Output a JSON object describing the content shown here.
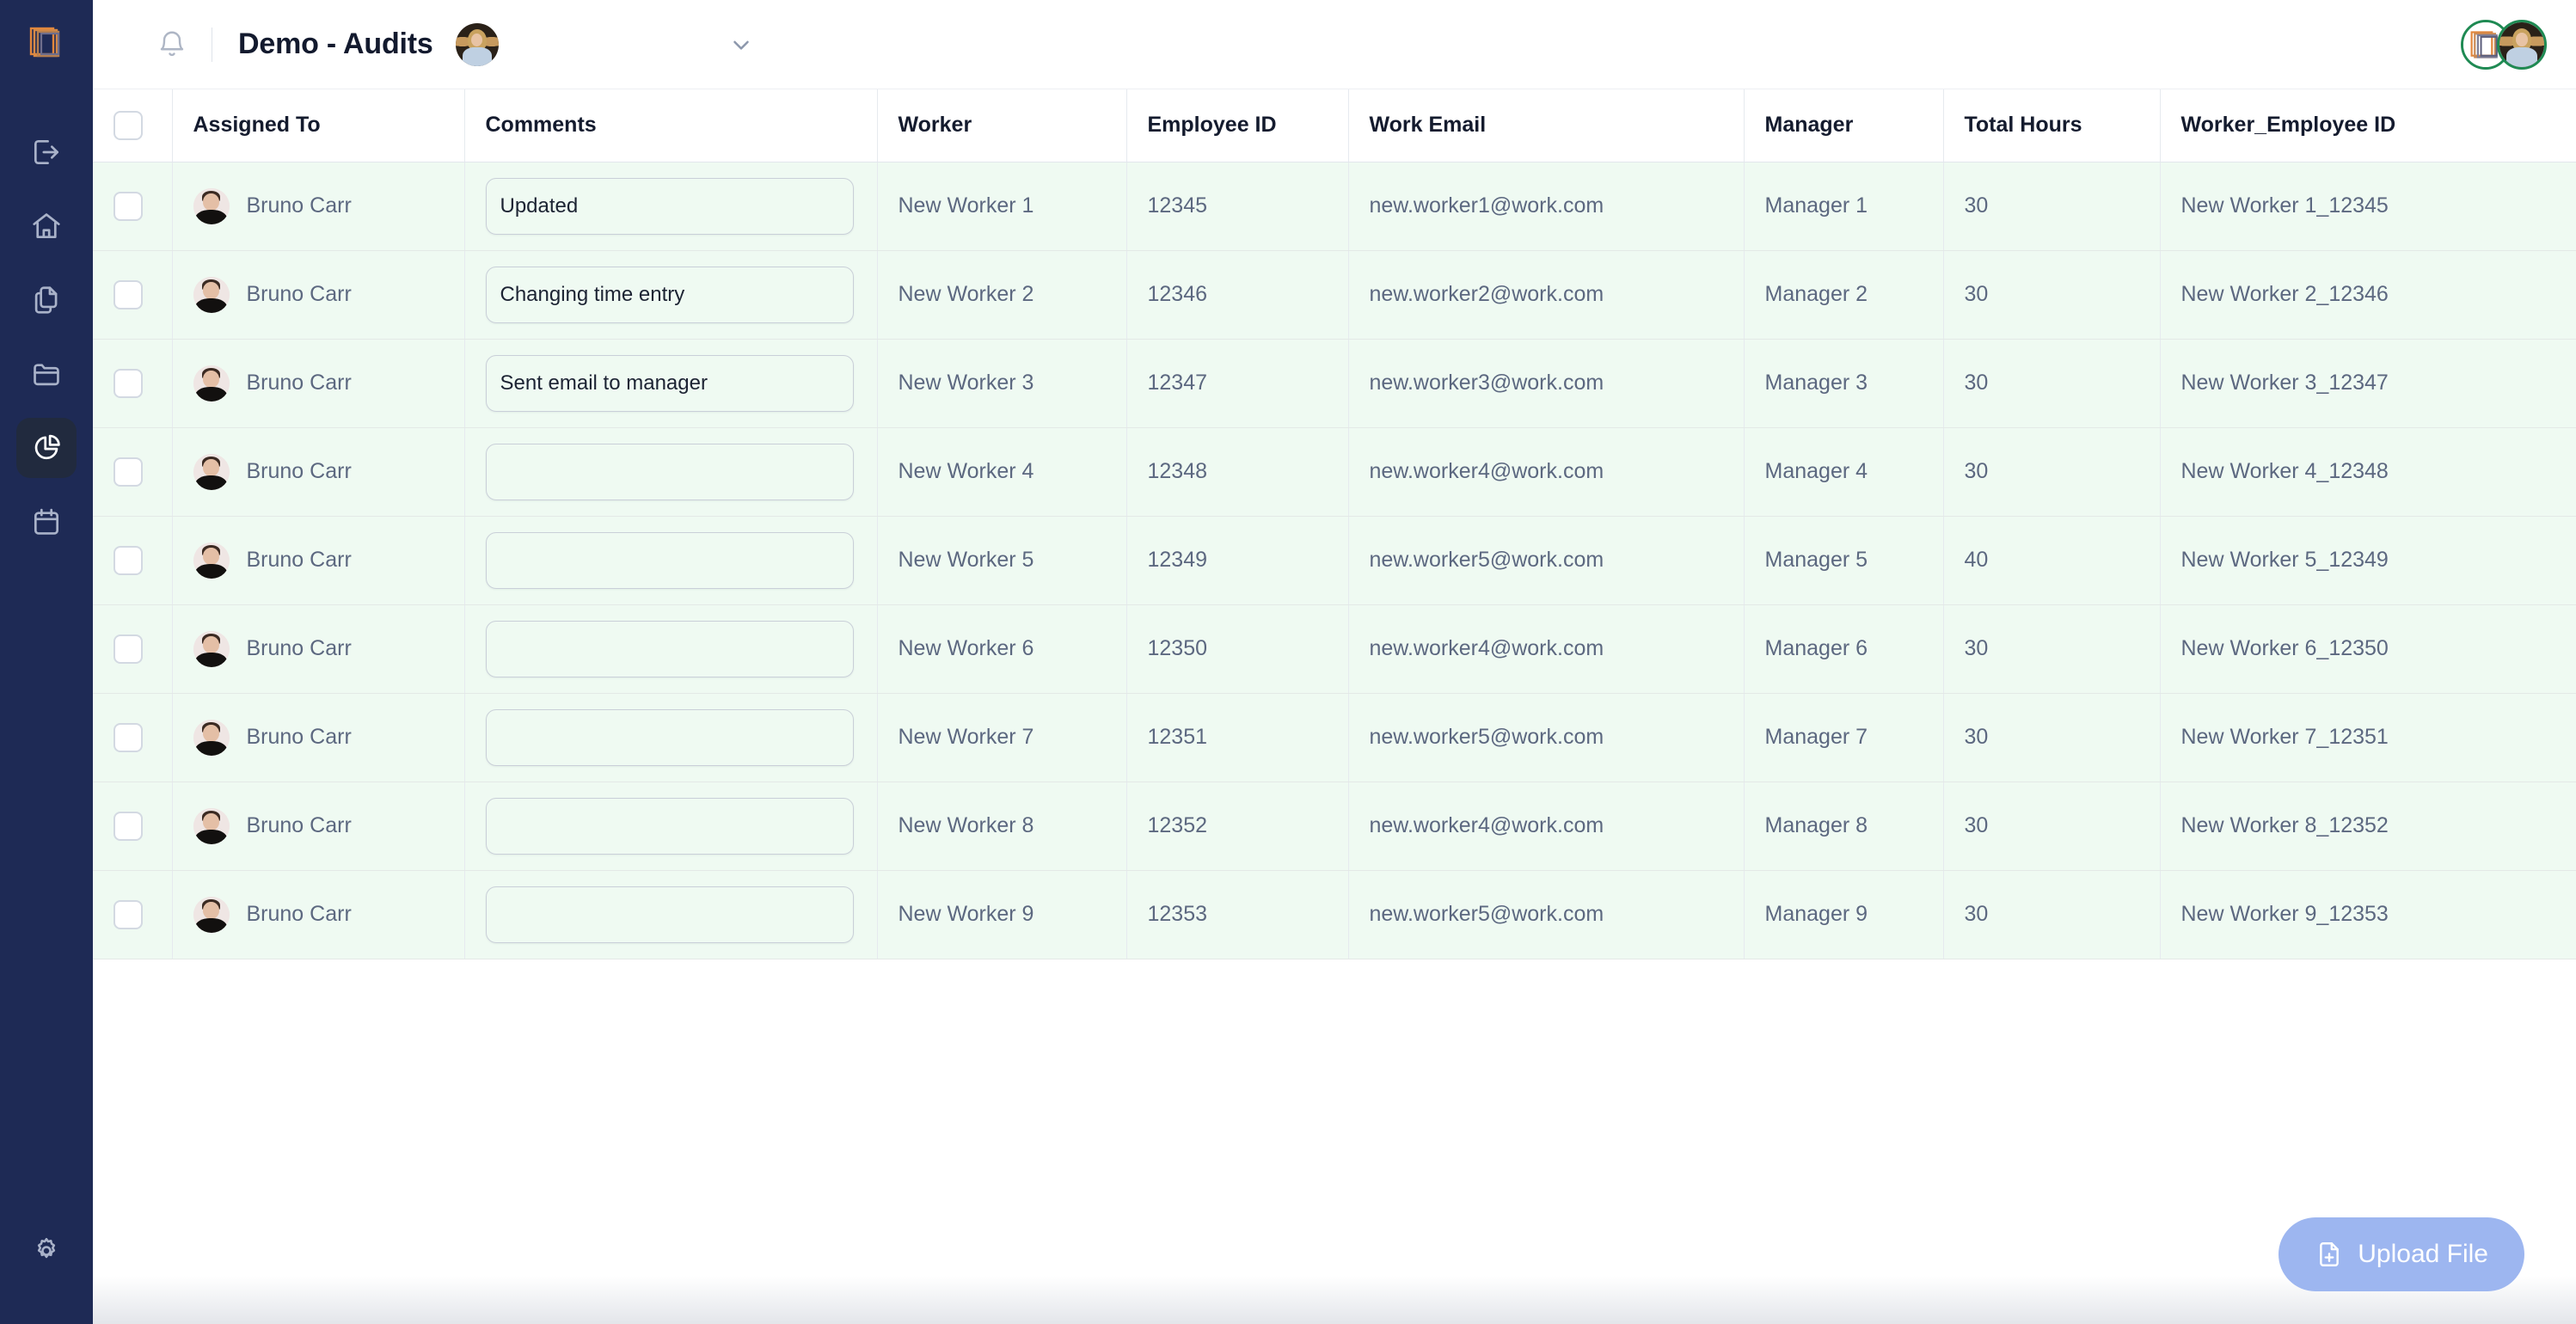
{
  "app": {
    "logo_name": "nested-squares-logo",
    "logo_color": "#E2873C",
    "sidebar_bg": "#1E2A55",
    "accent_green": "#1F8A53",
    "row_tint": "#EFFAF2",
    "upload_button_color": "#9DB6F0"
  },
  "sidebar": {
    "items": [
      {
        "name": "logout",
        "icon": "logout-icon",
        "active": false
      },
      {
        "name": "home",
        "icon": "home-icon",
        "active": false
      },
      {
        "name": "documents",
        "icon": "documents-copy-icon",
        "active": false
      },
      {
        "name": "folders",
        "icon": "folder-icon",
        "active": false
      },
      {
        "name": "reports",
        "icon": "pie-chart-icon",
        "active": true
      },
      {
        "name": "calendar",
        "icon": "calendar-icon",
        "active": false
      }
    ],
    "settings": {
      "name": "settings",
      "icon": "gear-icon"
    }
  },
  "header": {
    "bell_icon": "bell-icon",
    "title": "Demo - Audits",
    "title_avatar": "user-avatar",
    "chevron_icon": "chevron-down-icon",
    "presence_avatars": [
      "workspace-logo-avatar",
      "user-avatar"
    ]
  },
  "table": {
    "select_all_checkbox": "",
    "columns": [
      "Assigned To",
      "Comments",
      "Worker",
      "Employee ID",
      "Work Email",
      "Manager",
      "Total Hours",
      "Worker_Employee ID"
    ],
    "comment_placeholder": "",
    "rows": [
      {
        "assigned_to": "Bruno Carr",
        "comment": "Updated",
        "worker": "New Worker 1",
        "employee_id": "12345",
        "work_email": "new.worker1@work.com",
        "manager": "Manager 1",
        "total_hours": "30",
        "worker_employee_id": "New Worker 1_12345"
      },
      {
        "assigned_to": "Bruno Carr",
        "comment": "Changing time entry",
        "worker": "New Worker 2",
        "employee_id": "12346",
        "work_email": "new.worker2@work.com",
        "manager": "Manager 2",
        "total_hours": "30",
        "worker_employee_id": "New Worker 2_12346"
      },
      {
        "assigned_to": "Bruno Carr",
        "comment": "Sent email to manager",
        "worker": "New Worker 3",
        "employee_id": "12347",
        "work_email": "new.worker3@work.com",
        "manager": "Manager 3",
        "total_hours": "30",
        "worker_employee_id": "New Worker 3_12347"
      },
      {
        "assigned_to": "Bruno Carr",
        "comment": "",
        "worker": "New Worker 4",
        "employee_id": "12348",
        "work_email": "new.worker4@work.com",
        "manager": "Manager 4",
        "total_hours": "30",
        "worker_employee_id": "New Worker 4_12348"
      },
      {
        "assigned_to": "Bruno Carr",
        "comment": "",
        "worker": "New Worker 5",
        "employee_id": "12349",
        "work_email": "new.worker5@work.com",
        "manager": "Manager 5",
        "total_hours": "40",
        "worker_employee_id": "New Worker 5_12349"
      },
      {
        "assigned_to": "Bruno Carr",
        "comment": "",
        "worker": "New Worker 6",
        "employee_id": "12350",
        "work_email": "new.worker4@work.com",
        "manager": "Manager 6",
        "total_hours": "30",
        "worker_employee_id": "New Worker 6_12350"
      },
      {
        "assigned_to": "Bruno Carr",
        "comment": "",
        "worker": "New Worker 7",
        "employee_id": "12351",
        "work_email": "new.worker5@work.com",
        "manager": "Manager 7",
        "total_hours": "30",
        "worker_employee_id": "New Worker 7_12351"
      },
      {
        "assigned_to": "Bruno Carr",
        "comment": "",
        "worker": "New Worker 8",
        "employee_id": "12352",
        "work_email": "new.worker4@work.com",
        "manager": "Manager 8",
        "total_hours": "30",
        "worker_employee_id": "New Worker 8_12352"
      },
      {
        "assigned_to": "Bruno Carr",
        "comment": "",
        "worker": "New Worker 9",
        "employee_id": "12353",
        "work_email": "new.worker5@work.com",
        "manager": "Manager 9",
        "total_hours": "30",
        "worker_employee_id": "New Worker 9_12353"
      }
    ]
  },
  "upload": {
    "label": "Upload File",
    "icon": "file-plus-icon"
  }
}
